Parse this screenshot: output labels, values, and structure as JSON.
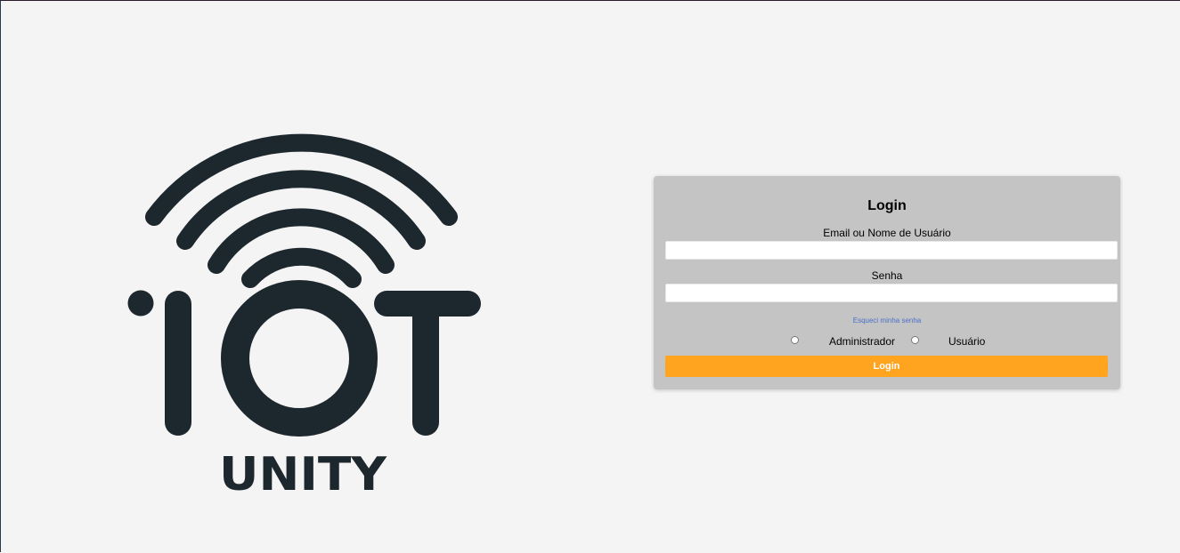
{
  "logo": {
    "text": "UNITY",
    "brand_letters": "IOT",
    "color": "#1d272e"
  },
  "login": {
    "title": "Login",
    "email_label": "Email ou Nome de Usuário",
    "email_value": "",
    "password_label": "Senha",
    "password_value": "",
    "forgot_link": "Esqueci minha senha",
    "roles": [
      {
        "label": "Administrador",
        "selected": false
      },
      {
        "label": "Usuário",
        "selected": false
      }
    ],
    "submit_label": "Login",
    "accent_color": "#ffa41f"
  }
}
